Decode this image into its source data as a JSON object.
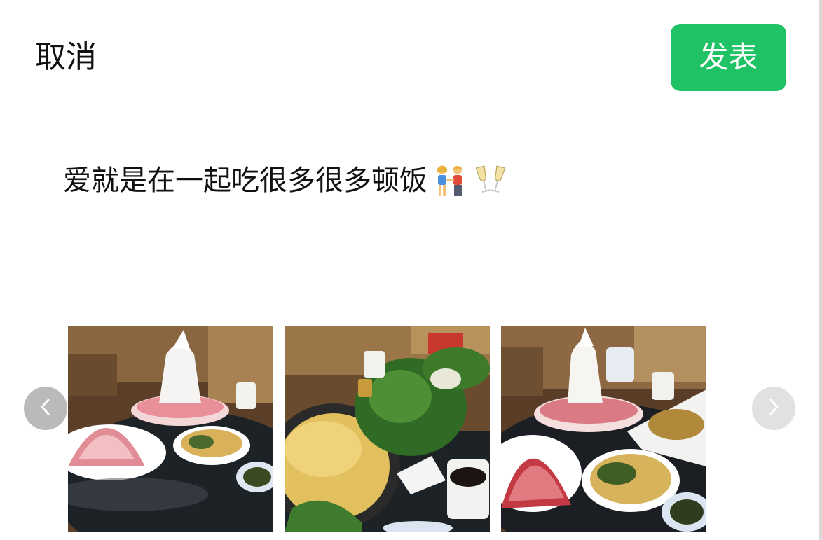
{
  "header": {
    "cancel_label": "取消",
    "publish_label": "发表"
  },
  "post": {
    "text": "爱就是在一起吃很多很多顿饭",
    "emojis": [
      "couple-holding-hands-icon",
      "clinking-glasses-icon"
    ]
  },
  "photos": [
    {
      "name": "photo-1",
      "content": "hotpot-table-with-horse-figure-and-meat-platters"
    },
    {
      "name": "photo-2",
      "content": "hotpot-with-broth-and-greens"
    },
    {
      "name": "photo-3",
      "content": "hotpot-table-with-horse-figure-and-meat-platters"
    }
  ],
  "carousel": {
    "prev_icon": "chevron-left-icon",
    "next_icon": "chevron-right-icon"
  },
  "colors": {
    "publish_bg": "#1fc264",
    "publish_text": "#ffffff",
    "text": "#111111"
  }
}
